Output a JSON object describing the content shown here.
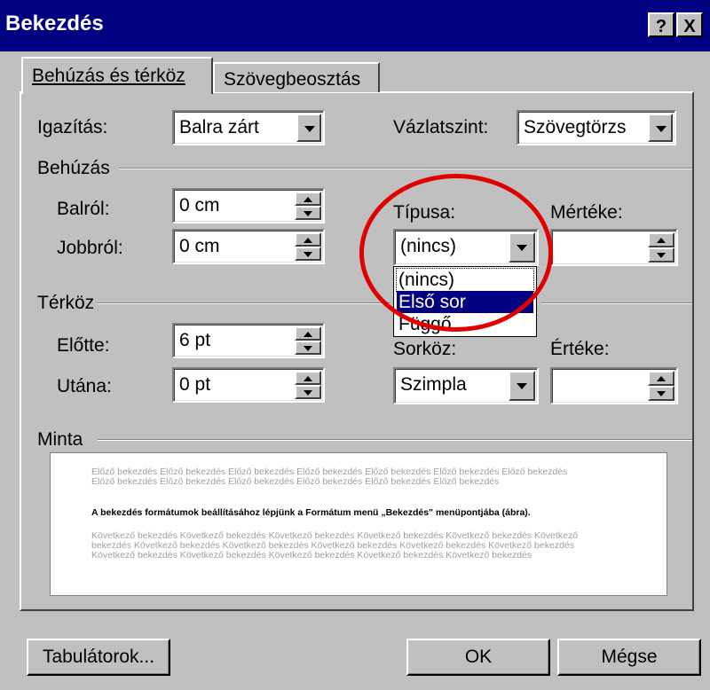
{
  "window": {
    "title": "Bekezdés",
    "help_label": "?",
    "close_label": "X"
  },
  "tabs": [
    {
      "label": "Behúzás és térköz",
      "active": true
    },
    {
      "label": "Szövegbeosztás",
      "active": false
    }
  ],
  "alignment": {
    "label": "Igazítás:",
    "value": "Balra zárt"
  },
  "outline_level": {
    "label": "Vázlatszint:",
    "value": "Szövegtörzs"
  },
  "indent_group": {
    "title": "Behúzás",
    "left": {
      "label": "Balról:",
      "value": "0 cm"
    },
    "right": {
      "label": "Jobbról:",
      "value": "0 cm"
    },
    "special": {
      "label": "Típusa:",
      "value": "(nincs)",
      "options": [
        "(nincs)",
        "Első sor",
        "Függő"
      ],
      "highlighted": "Első sor"
    },
    "by": {
      "label": "Mértéke:",
      "value": ""
    }
  },
  "spacing_group": {
    "title": "Térköz",
    "before": {
      "label": "Előtte:",
      "value": "6 pt"
    },
    "after": {
      "label": "Utána:",
      "value": "0 pt"
    },
    "line_spacing": {
      "label": "Sorköz:",
      "value": "Szimpla"
    },
    "at": {
      "label": "Értéke:",
      "value": ""
    }
  },
  "preview": {
    "title": "Minta",
    "previous_text": "Előző bekezdés Előző bekezdés Előző bekezdés Előző bekezdés Előző bekezdés Előző bekezdés Előző bekezdés Előző bekezdés Előző bekezdés Előző bekezdés Előző bekezdés Előző bekezdés Előző bekezdés",
    "current_text": "A bekezdés formátumok beállításához lépjünk a Formátum menü „Bekezdés\" menüpontjába (ábra).",
    "next_text": "Következő bekezdés Következő bekezdés Következő bekezdés Következő bekezdés Következő bekezdés Következő bekezdés Következő bekezdés Következő bekezdés Következő bekezdés Következő bekezdés Következő bekezdés Következő bekezdés Következő bekezdés Következő bekezdés Következő bekezdés Következő bekezdés"
  },
  "buttons": {
    "tabs": "Tabulátorok...",
    "ok": "OK",
    "cancel": "Mégse"
  },
  "colors": {
    "titlebar": "#000080",
    "face": "#c0c0c0",
    "annotation": "#e00000",
    "selection": "#000080"
  }
}
